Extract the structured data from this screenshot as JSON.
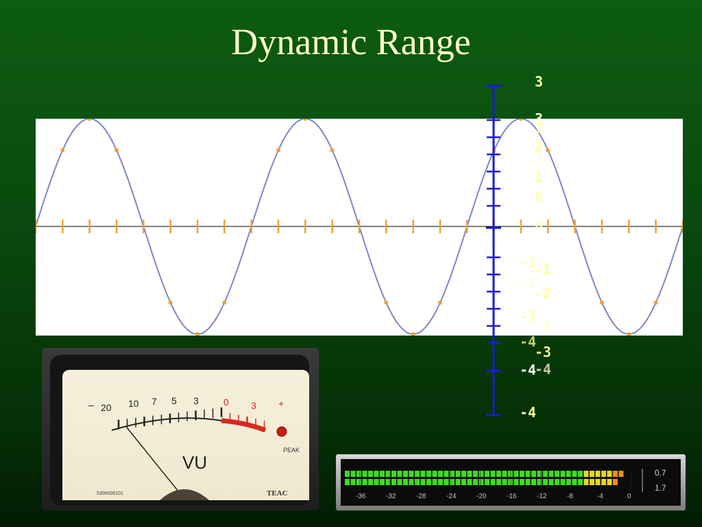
{
  "slide": {
    "title": "Dynamic Range"
  },
  "wave_plot": {
    "cycles": 3,
    "amplitude": 1,
    "points_per_cycle": 8,
    "curve_color": "#7b86c8",
    "marker_color": "#f0a030",
    "axis_color": "#000000"
  },
  "level_scale": {
    "color": "#1a1ad4",
    "top_label": "3",
    "bottom_label": "-4",
    "accent_label": "-4",
    "overlap_labels": [
      "3",
      "2",
      "2",
      "1",
      "1",
      "0",
      "0",
      "-1",
      "-1",
      "-2",
      "-2",
      "-3",
      "-3",
      "-4",
      "-3",
      "-4"
    ]
  },
  "vu_meter": {
    "scale_black": [
      "–",
      "20",
      "10",
      "7",
      "5",
      "3"
    ],
    "scale_red": [
      "0",
      "3",
      "+"
    ],
    "label": "VU",
    "peak_label": "PEAK",
    "serial": "5306006101",
    "brand": "TEAC",
    "needle_level_db": -20
  },
  "digital_meter": {
    "scale": [
      "-36",
      "-32",
      "-28",
      "-24",
      "-20",
      "-16",
      "-12",
      "-8",
      "-4",
      "0"
    ],
    "readouts": [
      "0.7",
      "1.7"
    ],
    "channel_levels_db": [
      -0.7,
      -1.7
    ],
    "colors": {
      "green": "#3ddc1e",
      "yellow": "#e8d81a",
      "orange": "#f08a1a",
      "red": "#e03a1a"
    }
  },
  "colors": {
    "title": "#ffffcc",
    "background_top": "#0d5c12",
    "background_bottom": "#021c03",
    "label_yellow": "#ffff99",
    "label_white": "#ffffff"
  }
}
